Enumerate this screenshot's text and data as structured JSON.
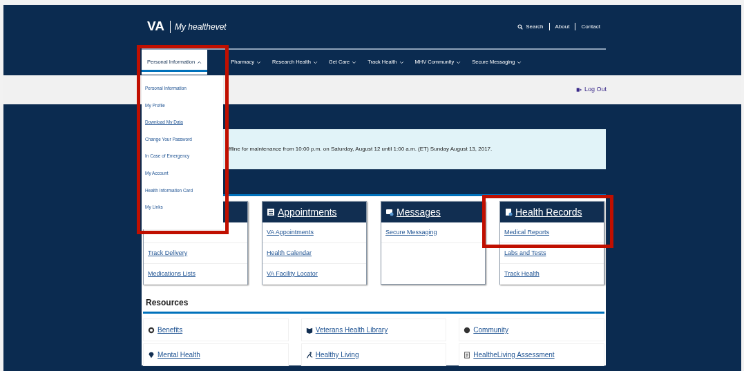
{
  "header": {
    "logo_short": "VA",
    "logo_name": "My healthevet",
    "links": [
      "Search",
      "About",
      "Contact"
    ]
  },
  "nav": [
    {
      "label": "Personal Information",
      "selected": true,
      "expanded": true
    },
    {
      "label": "Pharmacy",
      "selected": false,
      "expanded": false
    },
    {
      "label": "Research Health",
      "selected": false,
      "expanded": false
    },
    {
      "label": "Get Care",
      "selected": false,
      "expanded": false
    },
    {
      "label": "Track Health",
      "selected": false,
      "expanded": false
    },
    {
      "label": "MHV Community",
      "selected": false,
      "expanded": false
    },
    {
      "label": "Secure Messaging",
      "selected": false,
      "expanded": false
    }
  ],
  "dropdown": [
    {
      "label": "Personal Information",
      "hovered": false
    },
    {
      "label": "My Profile",
      "hovered": false
    },
    {
      "label": "Download My Data",
      "hovered": true
    },
    {
      "label": "Change Your Password",
      "hovered": false
    },
    {
      "label": "In Case of Emergency",
      "hovered": false
    },
    {
      "label": "My Account",
      "hovered": false
    },
    {
      "label": "Health Information Card",
      "hovered": false
    },
    {
      "label": "My Links",
      "hovered": false
    }
  ],
  "logout": "Log Out",
  "alert": "ffline for maintenance from 10:00 p.m. on Saturday, August 12 until 1:00 a.m. (ET) Sunday August 13, 2017.",
  "cards": [
    {
      "links": [
        "Track Delivery",
        "Medications Lists"
      ]
    },
    {
      "title": "Appointments",
      "links": [
        "VA Appointments",
        "Health Calendar",
        "VA Facility Locator"
      ]
    },
    {
      "title": "Messages",
      "links": [
        "Secure Messaging"
      ]
    },
    {
      "title": "Health Records",
      "links": [
        "Medical Reports",
        "Labs and Tests",
        "Track Health"
      ]
    }
  ],
  "resources": {
    "title": "Resources",
    "items": [
      "Benefits",
      "Veterans Health Library",
      "Community",
      "Mental Health",
      "Healthy Living",
      "HealtheLiving Assessment"
    ]
  }
}
